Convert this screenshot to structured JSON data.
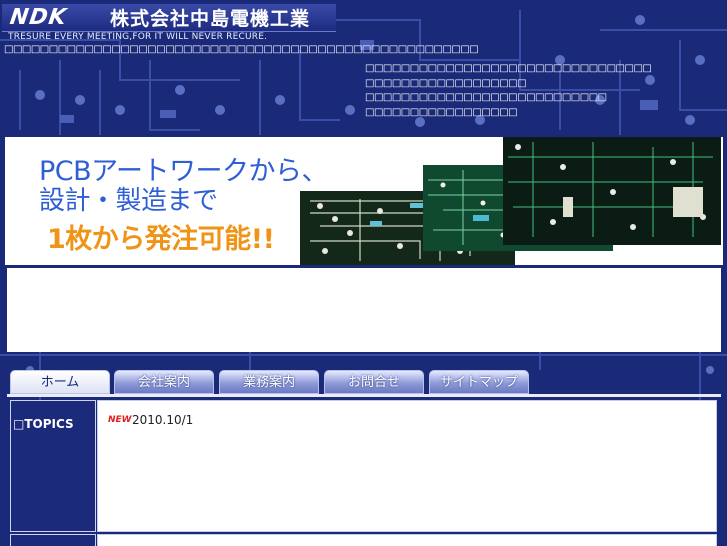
{
  "header": {
    "logo_text": "NDK",
    "company_name": "株式会社中島電機工業",
    "tagline": "TRESURE EVERY MEETING,FOR IT WILL NEVER RECURE.",
    "garbled_line": "□□□□□□□□□□□□□□□□□□□□□□□□□□□□□□□□□□□□□□□□□□□□□□□□□□□□□",
    "garbled_block": [
      "□□□□□□□□□□□□□□□□□□□□□□□□□□□□□□□□",
      "□□□□□□□□□□□□□□□□□□",
      "□□□□□□□□□□□□□□□□□□□□□□□□□□□",
      "□□□□□□□□□□□□□□□□□"
    ]
  },
  "banner": {
    "line1": "PCBアートワークから、",
    "line2": "設計・製造まで",
    "line3": "1枚から発注可能!!"
  },
  "nav": {
    "tabs": [
      {
        "label": "ホーム",
        "active": true
      },
      {
        "label": "会社案内",
        "active": false
      },
      {
        "label": "業務案内",
        "active": false
      },
      {
        "label": "お問合せ",
        "active": false
      },
      {
        "label": "サイトマップ",
        "active": false
      }
    ]
  },
  "topics": {
    "label": "□TOPICS",
    "new_badge": "NEW",
    "date": "2010.10/1"
  },
  "colors": {
    "background": "#1a2a78",
    "banner_blue": "#2f5fd6",
    "banner_orange": "#f09418",
    "new_red": "#e02020"
  }
}
